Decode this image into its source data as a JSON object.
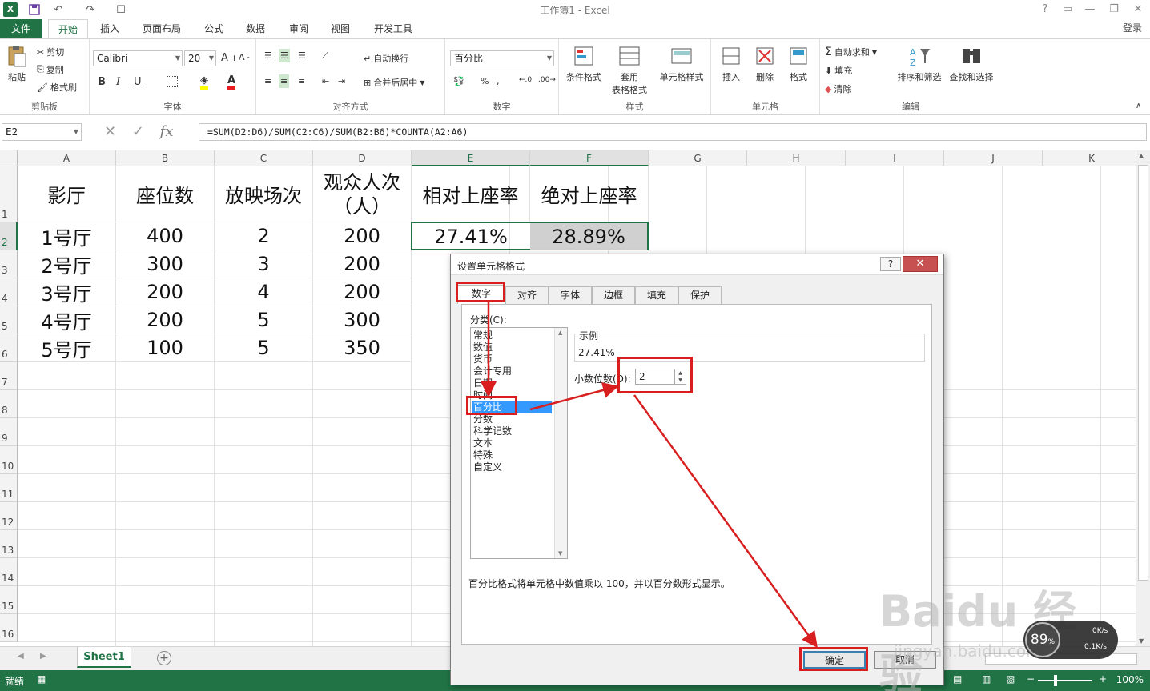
{
  "window": {
    "title": "工作簿1 - Excel",
    "login": "登录"
  },
  "quick_access": [
    "save-icon",
    "undo-icon",
    "redo-icon",
    "touch-mode-icon"
  ],
  "tabs": [
    "文件",
    "开始",
    "插入",
    "页面布局",
    "公式",
    "数据",
    "审阅",
    "视图",
    "开发工具"
  ],
  "active_tab": "开始",
  "ribbon": {
    "clipboard": {
      "paste": "粘贴",
      "cut": "剪切",
      "copy": "复制",
      "format_painter": "格式刷",
      "label": "剪贴板"
    },
    "font": {
      "name": "Calibri",
      "size": "20",
      "bold": "B",
      "italic": "I",
      "underline": "U",
      "label": "字体"
    },
    "alignment": {
      "wrap": "自动换行",
      "merge": "合并后居中",
      "label": "对齐方式"
    },
    "number": {
      "format": "百分比",
      "label": "数字"
    },
    "styles": {
      "conditional": "条件格式",
      "table_format_1": "套用",
      "table_format_2": "表格格式",
      "cell_styles": "单元格样式",
      "label": "样式"
    },
    "cells": {
      "insert": "插入",
      "delete": "删除",
      "format": "格式",
      "label": "单元格"
    },
    "editing": {
      "autosum": "自动求和",
      "fill": "填充",
      "clear": "清除",
      "sort": "排序和筛选",
      "find": "查找和选择",
      "label": "编辑"
    }
  },
  "formula_bar": {
    "name_box": "E2",
    "fx": "fx",
    "formula": "=SUM(D2:D6)/SUM(C2:C6)/SUM(B2:B6)*COUNTA(A2:A6)"
  },
  "columns": [
    "A",
    "B",
    "C",
    "D",
    "E",
    "F",
    "G",
    "H",
    "I",
    "J",
    "K"
  ],
  "rows": [
    "1",
    "2",
    "3",
    "4",
    "5",
    "6",
    "7",
    "8",
    "9",
    "10",
    "11",
    "12",
    "13",
    "14",
    "15",
    "16"
  ],
  "cells": {
    "header": [
      "影厅",
      "座位数",
      "放映场次",
      "观众人次（人）",
      "相对上座率",
      "绝对上座率"
    ],
    "data": [
      [
        "1号厅",
        "400",
        "2",
        "200",
        "27.41%",
        "28.89%"
      ],
      [
        "2号厅",
        "300",
        "3",
        "200",
        "",
        ""
      ],
      [
        "3号厅",
        "200",
        "4",
        "200",
        "",
        ""
      ],
      [
        "4号厅",
        "200",
        "5",
        "300",
        "",
        ""
      ],
      [
        "5号厅",
        "100",
        "5",
        "350",
        "",
        ""
      ]
    ]
  },
  "sheet_tab": "Sheet1",
  "status": {
    "ready": "就绪",
    "zoom": "100%"
  },
  "dialog": {
    "title": "设置单元格格式",
    "help": "?",
    "tabs": [
      "数字",
      "对齐",
      "字体",
      "边框",
      "填充",
      "保护"
    ],
    "category_label": "分类(C):",
    "categories": [
      "常规",
      "数值",
      "货币",
      "会计专用",
      "日期",
      "时间",
      "百分比",
      "分数",
      "科学记数",
      "文本",
      "特殊",
      "自定义"
    ],
    "selected_category": "百分比",
    "sample_label": "示例",
    "sample_value": "27.41%",
    "decimal_label": "小数位数(D):",
    "decimal_value": "2",
    "description": "百分比格式将单元格中数值乘以 100，并以百分数形式显示。",
    "ok": "确定",
    "cancel": "取消"
  },
  "network_widget": {
    "percent": "89",
    "up": "0K/s",
    "down": "0.1K/s"
  },
  "watermark": {
    "brand": "Baidu 经验",
    "url": "jingyan.baidu.com"
  },
  "colors": {
    "excel_green": "#217346",
    "annotation_red": "#d81e1e",
    "selection_blue": "#3399ff"
  }
}
